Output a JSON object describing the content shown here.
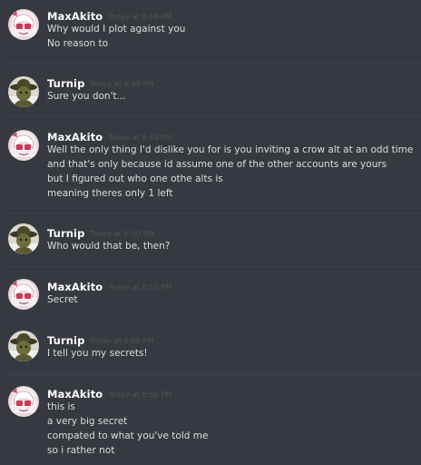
{
  "messages": [
    {
      "author": "MaxAkito",
      "avatar": "maxakito-avatar",
      "timestamp": "Today at 6:48 PM",
      "lines": [
        "Why would I plot against you",
        "No reason to"
      ]
    },
    {
      "author": "Turnip",
      "avatar": "turnip-avatar",
      "timestamp": "Today at 6:48 PM",
      "lines": [
        "Sure you don't..."
      ]
    },
    {
      "author": "MaxAkito",
      "avatar": "maxakito-avatar",
      "timestamp": "Today at 6:49 PM",
      "lines": [
        "Well the only thing I'd dislike you for is you inviting a crow alt at an odd time",
        "and that's only because id assume one of the other accounts are yours",
        "but I figured out who one othe alts is",
        "meaning theres only 1 left"
      ]
    },
    {
      "author": "Turnip",
      "avatar": "turnip-avatar",
      "timestamp": "Today at 6:50 PM",
      "lines": [
        "Who would that be, then?"
      ]
    },
    {
      "author": "MaxAkito",
      "avatar": "maxakito-avatar",
      "timestamp": "Today at 6:50 PM",
      "lines": [
        "Secret"
      ]
    },
    {
      "author": "Turnip",
      "avatar": "turnip-avatar",
      "timestamp": "Today at 6:50 PM",
      "lines": [
        "I tell you my secrets!"
      ]
    },
    {
      "author": "MaxAkito",
      "avatar": "maxakito-avatar",
      "timestamp": "Today at 6:50 PM",
      "lines": [
        "this is",
        "a very big secret",
        "compated to what you've told me",
        "so i rather not"
      ]
    }
  ]
}
